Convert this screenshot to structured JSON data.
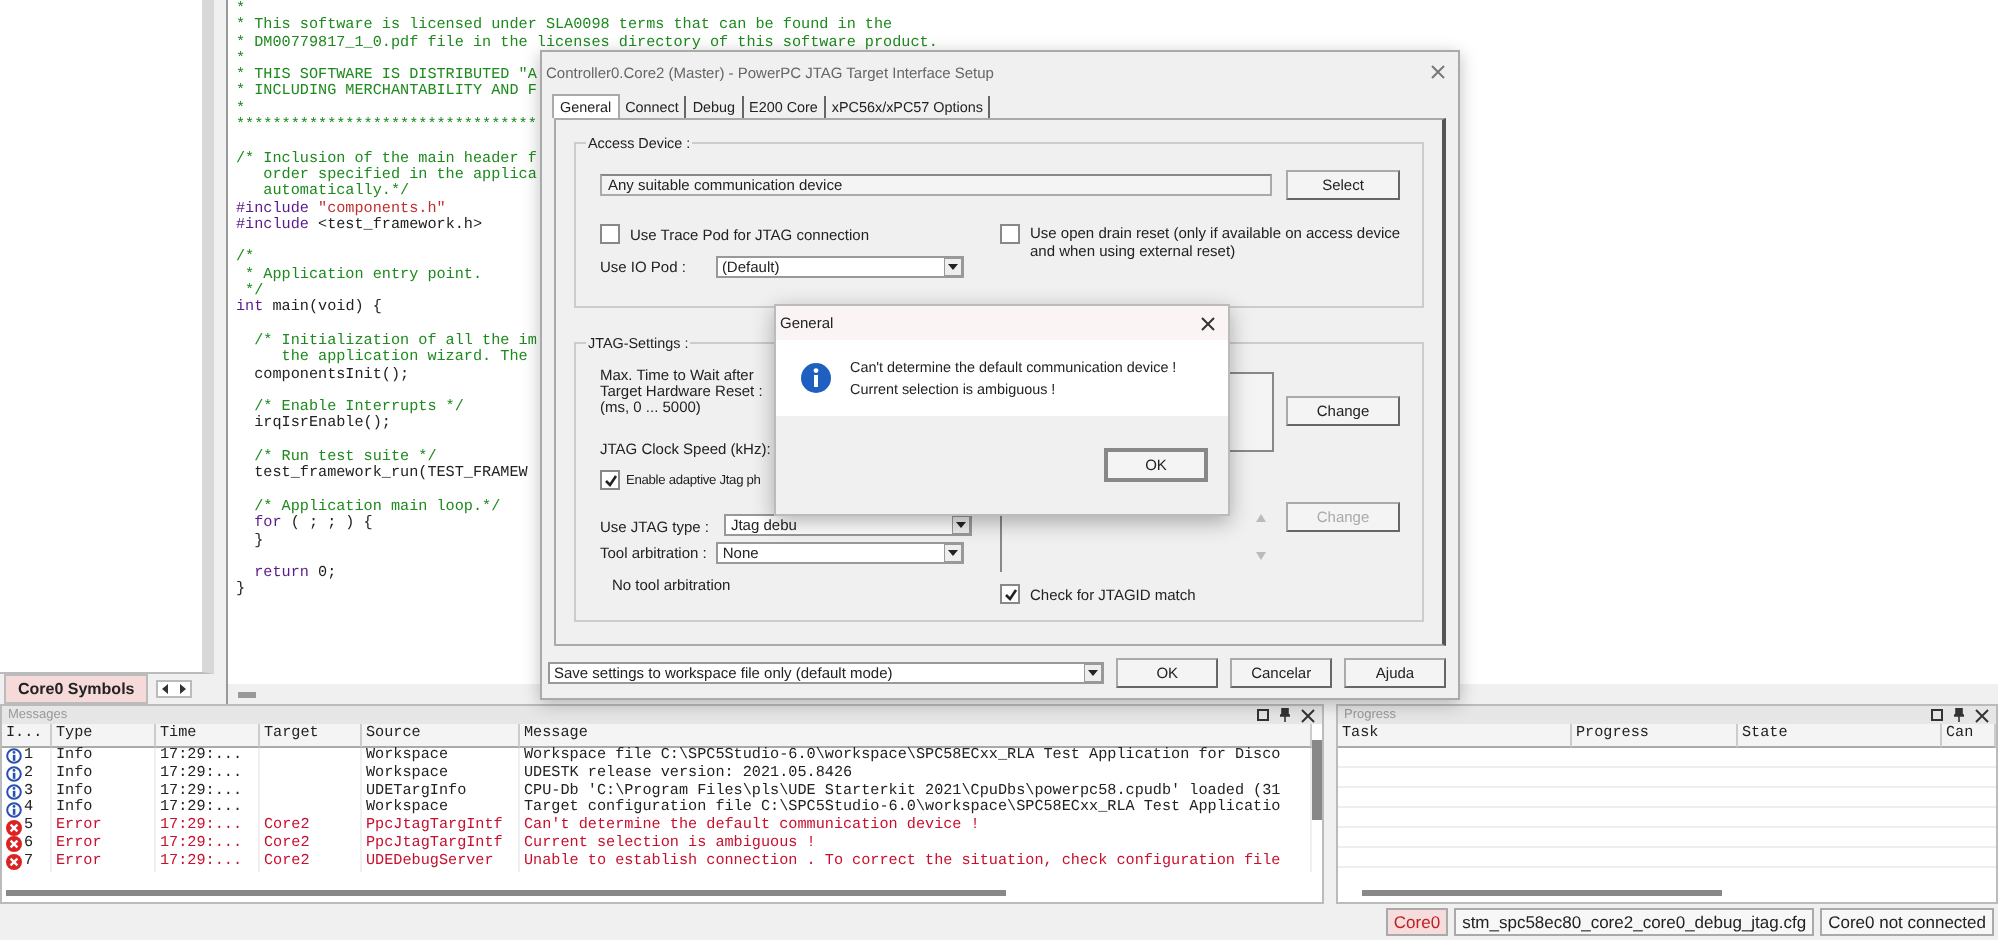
{
  "sidebar": {
    "tabs": [
      {
        "label": "Core0 Symbols",
        "selected": true
      }
    ]
  },
  "editor": {
    "lines": [
      {
        "kind": "text",
        "segments": [
          {
            "kind": "comment",
            "text": "*"
          }
        ]
      },
      {
        "kind": "text",
        "segments": [
          {
            "kind": "comment",
            "text": "* This software is licensed under SLA0098 terms that can be found in the"
          }
        ]
      },
      {
        "kind": "text",
        "segments": [
          {
            "kind": "comment",
            "text": "* DM00779817_1_0.pdf file in the licenses directory of this software product."
          }
        ]
      },
      {
        "kind": "text",
        "segments": [
          {
            "kind": "comment",
            "text": "*"
          }
        ]
      },
      {
        "kind": "text",
        "segments": [
          {
            "kind": "comment",
            "text": "* THIS SOFTWARE IS DISTRIBUTED \"A"
          }
        ]
      },
      {
        "kind": "text",
        "segments": [
          {
            "kind": "comment",
            "text": "* INCLUDING MERCHANTABILITY AND F"
          }
        ]
      },
      {
        "kind": "text",
        "segments": [
          {
            "kind": "comment",
            "text": "*"
          }
        ]
      },
      {
        "kind": "text",
        "segments": [
          {
            "kind": "comment",
            "text": "*********************************"
          }
        ]
      },
      {
        "kind": "blank"
      },
      {
        "kind": "text",
        "segments": [
          {
            "kind": "comment",
            "text": "/* Inclusion of the main header f"
          }
        ]
      },
      {
        "kind": "text",
        "segments": [
          {
            "kind": "comment",
            "text": "   order specified in the applica"
          }
        ]
      },
      {
        "kind": "text",
        "segments": [
          {
            "kind": "comment",
            "text": "   automatically.*/"
          }
        ]
      },
      {
        "kind": "text",
        "segments": [
          {
            "kind": "keyword",
            "text": "#include "
          },
          {
            "kind": "string",
            "text": "\"components.h\""
          }
        ]
      },
      {
        "kind": "text",
        "segments": [
          {
            "kind": "keyword",
            "text": "#include "
          },
          {
            "kind": "plain",
            "text": "<test_framework.h>"
          }
        ]
      },
      {
        "kind": "blank"
      },
      {
        "kind": "text",
        "segments": [
          {
            "kind": "comment",
            "text": "/*"
          }
        ]
      },
      {
        "kind": "text",
        "segments": [
          {
            "kind": "comment",
            "text": " * Application entry point."
          }
        ]
      },
      {
        "kind": "text",
        "segments": [
          {
            "kind": "comment",
            "text": " */"
          }
        ]
      },
      {
        "kind": "text",
        "segments": [
          {
            "kind": "keyword",
            "text": "int "
          },
          {
            "kind": "plain",
            "text": "main(void) {"
          }
        ]
      },
      {
        "kind": "blank"
      },
      {
        "kind": "text",
        "segments": [
          {
            "kind": "comment",
            "text": "  /* Initialization of all the im"
          }
        ]
      },
      {
        "kind": "text",
        "segments": [
          {
            "kind": "comment",
            "text": "     the application wizard. The"
          }
        ]
      },
      {
        "kind": "text",
        "segments": [
          {
            "kind": "plain",
            "text": "  componentsInit();"
          }
        ]
      },
      {
        "kind": "blank"
      },
      {
        "kind": "text",
        "segments": [
          {
            "kind": "comment",
            "text": "  /* Enable Interrupts */"
          }
        ]
      },
      {
        "kind": "text",
        "segments": [
          {
            "kind": "plain",
            "text": "  irqIsrEnable();"
          }
        ]
      },
      {
        "kind": "blank"
      },
      {
        "kind": "text",
        "segments": [
          {
            "kind": "comment",
            "text": "  /* Run test suite */"
          }
        ]
      },
      {
        "kind": "text",
        "segments": [
          {
            "kind": "plain",
            "text": "  test_framework_run(TEST_FRAMEW"
          }
        ]
      },
      {
        "kind": "blank"
      },
      {
        "kind": "text",
        "segments": [
          {
            "kind": "comment",
            "text": "  /* Application main loop.*/"
          }
        ]
      },
      {
        "kind": "text",
        "segments": [
          {
            "kind": "keyword",
            "text": "  for "
          },
          {
            "kind": "plain",
            "text": "( ; ; ) {"
          }
        ]
      },
      {
        "kind": "text",
        "segments": [
          {
            "kind": "plain",
            "text": "  }"
          }
        ]
      },
      {
        "kind": "blank"
      },
      {
        "kind": "text",
        "segments": [
          {
            "kind": "keyword",
            "text": "  return "
          },
          {
            "kind": "plain",
            "text": "0;"
          }
        ]
      },
      {
        "kind": "text",
        "segments": [
          {
            "kind": "plain",
            "text": "}"
          }
        ]
      }
    ]
  },
  "dialog": {
    "title": "Controller0.Core2 (Master) - PowerPC JTAG Target Interface Setup",
    "tabs": [
      {
        "label": "General",
        "selected": true
      },
      {
        "label": "Connect",
        "selected": false
      },
      {
        "label": "Debug",
        "selected": false
      },
      {
        "label": "E200 Core",
        "selected": false
      },
      {
        "label": "xPC56x/xPC57 Options",
        "selected": false
      }
    ],
    "access_device": {
      "legend": "Access Device :",
      "device": "Any suitable communication device",
      "select_button": "Select",
      "trace_pod": {
        "label": "Use Trace Pod for JTAG connection",
        "checked": false
      },
      "open_drain": {
        "label": "Use open drain reset (only if available on access device and when using external reset)",
        "checked": false
      },
      "io_pod": {
        "label": "Use IO Pod :",
        "value": "(Default)"
      }
    },
    "jtag_settings": {
      "legend": "JTAG-Settings :",
      "max_wait_lines": [
        "Max. Time to Wait after",
        "Target Hardware Reset :",
        "(ms, 0 ... 5000)"
      ],
      "clock_label": "JTAG Clock Speed (kHz):",
      "adaptive": {
        "label": "Enable adaptive Jtag ph",
        "checked": true
      },
      "jtag_type": {
        "label": "Use JTAG type :",
        "value": "Jtag debu"
      },
      "arbitration": {
        "label": "Tool arbitration :",
        "value": "None"
      },
      "arbitration_note": "No tool arbitration",
      "change_buttons": [
        {
          "label": "Change",
          "disabled": false
        },
        {
          "label": "Change",
          "disabled": true
        }
      ],
      "jtagid": {
        "label": "Check for JTAGID match",
        "checked": true
      }
    },
    "save_mode": "Save settings to workspace file only (default mode)",
    "buttons": [
      "OK",
      "Cancelar",
      "Ajuda"
    ]
  },
  "message_box": {
    "title": "General",
    "lines": [
      "Can't determine the default communication device !",
      "Current selection is ambiguous !"
    ],
    "button": "OK"
  },
  "messages_panel": {
    "title": "Messages",
    "columns": [
      "I...",
      "Type",
      "Time",
      "Target",
      "Source",
      "Message"
    ],
    "rows": [
      {
        "kind": "info",
        "index": "1",
        "type": "Info",
        "time": "17:29:...",
        "source": "Workspace",
        "message": "Workspace file C:\\SPC5Studio-6.0\\workspace\\SPC58ECxx_RLA Test Application for Disco"
      },
      {
        "kind": "info",
        "index": "2",
        "type": "Info",
        "time": "17:29:...",
        "source": "Workspace",
        "message": "UDESTK release version: 2021.05.8426"
      },
      {
        "kind": "info",
        "index": "3",
        "type": "Info",
        "time": "17:29:...",
        "source": "UDETargInfo",
        "message": "CPU-Db 'C:\\Program Files\\pls\\UDE Starterkit 2021\\CpuDbs\\powerpc58.cpudb' loaded (31"
      },
      {
        "kind": "info",
        "index": "4",
        "type": "Info",
        "time": "17:29:...",
        "source": "Workspace",
        "message": "Target configuration file C:\\SPC5Studio-6.0\\workspace\\SPC58ECxx_RLA Test Applicatio"
      },
      {
        "kind": "error",
        "index": "5",
        "type": "Error",
        "time": "17:29:...",
        "target": "Core2",
        "source": "PpcJtagTargIntf",
        "message": "Can't determine the default communication device !"
      },
      {
        "kind": "error",
        "index": "6",
        "type": "Error",
        "time": "17:29:...",
        "target": "Core2",
        "source": "PpcJtagTargIntf",
        "message": "Current selection is ambiguous !"
      },
      {
        "kind": "error",
        "index": "7",
        "type": "Error",
        "time": "17:29:...",
        "target": "Core2",
        "source": "UDEDebugServer",
        "message": "Unable to establish connection . To correct the situation, check configuration file"
      }
    ]
  },
  "progress_panel": {
    "title": "Progress",
    "columns": [
      "Task",
      "Progress",
      "State",
      "Can"
    ]
  },
  "status_bar": [
    {
      "kind": "highlight",
      "text": "Core0"
    },
    {
      "kind": "plain",
      "text": "stm_spc58ec80_core2_core0_debug_jtag.cfg"
    },
    {
      "kind": "plain",
      "text": "Core0 not connected"
    }
  ]
}
